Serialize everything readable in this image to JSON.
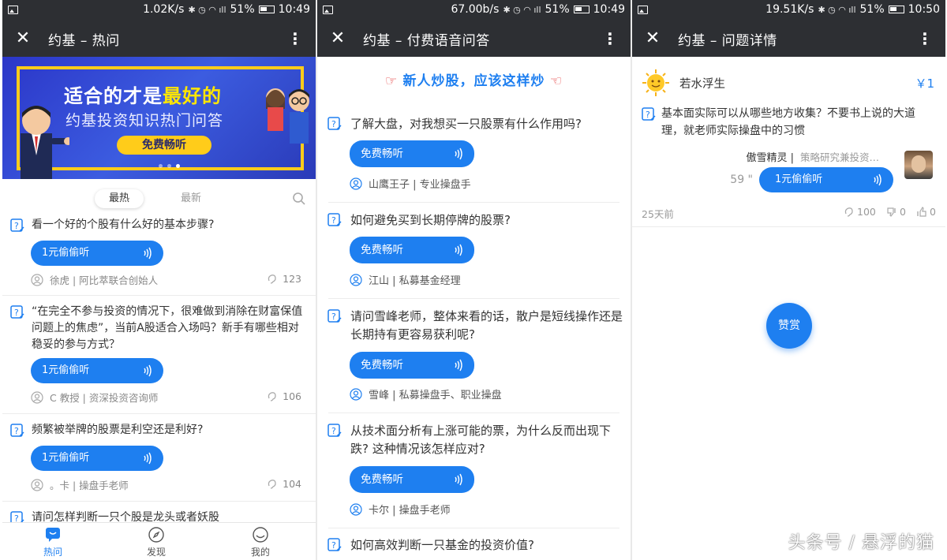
{
  "panels": [
    {
      "status": {
        "speed": "1.02K/s",
        "battery": "51%",
        "time": "10:49"
      },
      "title": "约基 – 热问"
    },
    {
      "status": {
        "speed": "67.00b/s",
        "battery": "51%",
        "time": "10:49"
      },
      "title": "约基 – 付费语音问答"
    },
    {
      "status": {
        "speed": "19.51K/s",
        "battery": "51%",
        "time": "10:50"
      },
      "title": "约基 – 问题详情"
    }
  ],
  "banner": {
    "line1_a": "适合的才是",
    "line1_b": "最好的",
    "line2": "约基投资知识热门问答",
    "button": "免费畅听"
  },
  "hot": {
    "tabs": [
      "最热",
      "最新"
    ],
    "items": [
      {
        "question": "看一个好的个股有什么好的基本步骤?",
        "listen": "1元偷偷听",
        "author": "徐虎 | 阿比萃联合创始人",
        "count": "123"
      },
      {
        "question": "“在完全不参与投资的情况下，很难做到消除在财富保值问题上的焦虑”，当前A股适合入场吗？新手有哪些相对稳妥的参与方式？",
        "listen": "1元偷偷听",
        "author": "C 教授 | 资深投资咨询师",
        "count": "106"
      },
      {
        "question": "频繁被举牌的股票是利空还是利好?",
        "listen": "1元偷偷听",
        "author": "。卡 | 操盘手老师",
        "count": "104"
      },
      {
        "question": "请问怎样判断一只个股是龙头或者妖股"
      }
    ],
    "nav": [
      "热问",
      "发现",
      "我的"
    ]
  },
  "paid": {
    "promo": "新人炒股，应该这样炒",
    "items": [
      {
        "question": "了解大盘，对我想买一只股票有什么作用吗?",
        "listen": "免费畅听",
        "author": "山鹰王子 | 专业操盘手"
      },
      {
        "question": "如何避免买到长期停牌的股票?",
        "listen": "免费畅听",
        "author": "江山 | 私募基金经理"
      },
      {
        "question": "请问雪峰老师，整体来看的话，散户是短线操作还是长期持有更容易获利呢?",
        "listen": "免费畅听",
        "author": "雪峰 | 私募操盘手、职业操盘"
      },
      {
        "question": "从技术面分析有上涨可能的票，为什么反而出现下跌? 这种情况该怎样应对?",
        "listen": "免费畅听",
        "author": "卡尔 | 操盘手老师"
      },
      {
        "question": "如何高效判断一只基金的投资价值?"
      }
    ]
  },
  "detail": {
    "asker": "若水浮生",
    "price": "￥1",
    "question": "基本面实际可以从哪些地方收集？不要书上说的大道理，就老师实际操盘中的习惯",
    "answerer": "傲雪精灵 |",
    "answerer_desc": "策略研究兼投资…",
    "duration": "59 \"",
    "listen": "1元偷偷听",
    "ago": "25天前",
    "listens": "100",
    "dislikes": "0",
    "likes": "0",
    "tip": "赞赏"
  },
  "watermark": "头条号 / 悬浮的猫",
  "colors": {
    "accent": "#1e7ff0",
    "bar": "#2d2f33",
    "banner": "#2b36c8",
    "banner_yellow": "#ffcc1a"
  }
}
